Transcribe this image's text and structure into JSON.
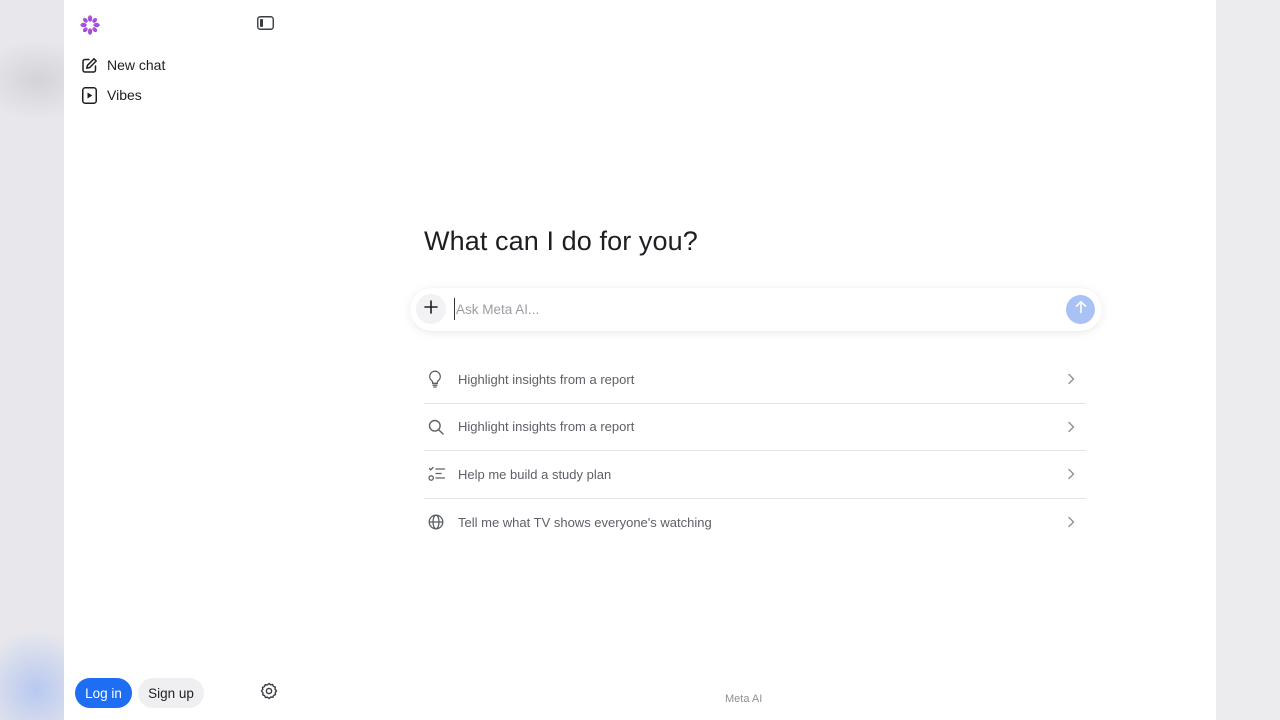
{
  "sidebar": {
    "logo_icon": "meta-ai-flower-icon",
    "collapse_icon": "sidebar-toggle-icon",
    "items": [
      {
        "label": "New chat",
        "icon": "compose-icon"
      },
      {
        "label": "Vibes",
        "icon": "play-video-icon"
      }
    ],
    "login_label": "Log in",
    "signup_label": "Sign up",
    "settings_icon": "gear-icon"
  },
  "main": {
    "headline": "What can I do for you?",
    "composer": {
      "placeholder": "Ask Meta AI...",
      "plus_icon": "plus-icon",
      "send_icon": "arrow-up-icon"
    },
    "suggestions": [
      {
        "label": "Highlight insights from a report",
        "icon": "lightbulb-icon"
      },
      {
        "label": "Highlight insights from a report",
        "icon": "search-icon"
      },
      {
        "label": "Help me build a study plan",
        "icon": "checklist-icon"
      },
      {
        "label": "Tell me what TV shows everyone's watching",
        "icon": "globe-icon"
      }
    ],
    "footer": "Meta AI"
  },
  "colors": {
    "accent": "#1d6ef2",
    "send_disabled": "#a9c2f5"
  }
}
